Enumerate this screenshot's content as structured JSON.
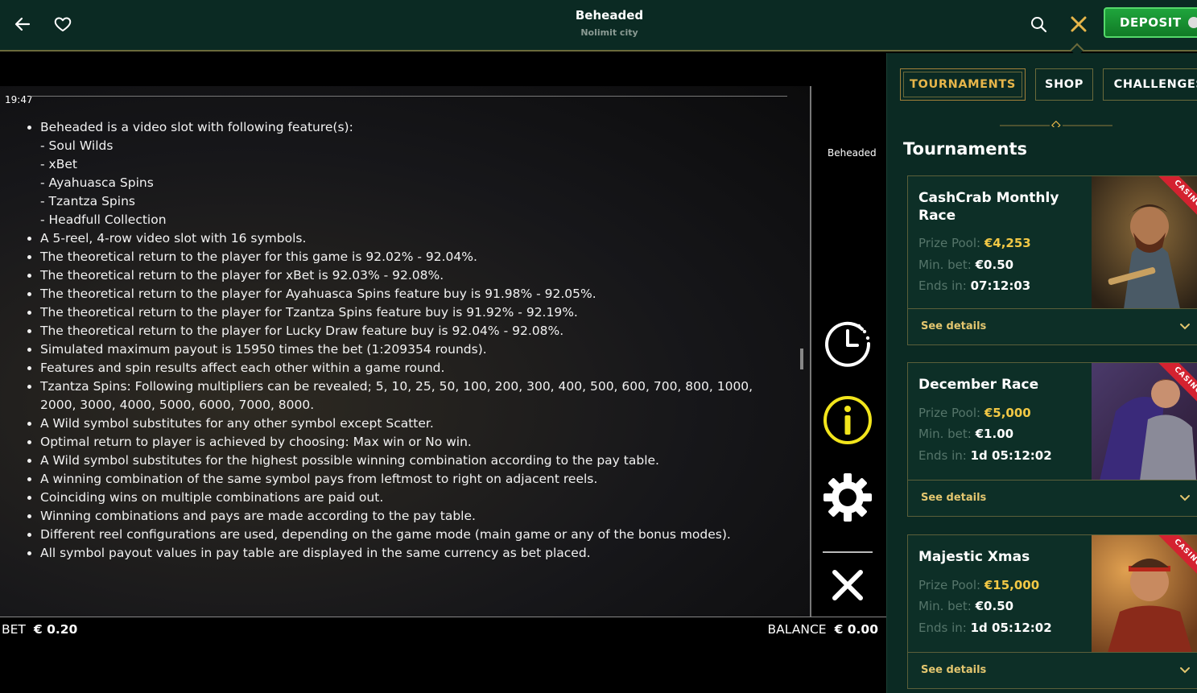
{
  "header": {
    "game_title": "Beheaded",
    "provider": "Nolimit city",
    "deposit_label": "DEPOSIT"
  },
  "game": {
    "clock": "19:47",
    "game_name": "Beheaded",
    "rules": [
      {
        "text": "Beheaded is a video slot with following feature(s):",
        "subs": [
          "- Soul Wilds",
          "- xBet",
          "- Ayahuasca Spins",
          "- Tzantza Spins",
          "- Headfull Collection"
        ]
      },
      {
        "text": "A 5-reel, 4-row video slot with 16 symbols."
      },
      {
        "text": "The theoretical return to the player for this game is 92.02% - 92.04%."
      },
      {
        "text": "The theoretical return to the player for xBet is 92.03% - 92.08%."
      },
      {
        "text": "The theoretical return to the player for Ayahuasca Spins feature buy is 91.98% - 92.05%."
      },
      {
        "text": "The theoretical return to the player for Tzantza Spins feature buy is 91.92% - 92.19%."
      },
      {
        "text": "The theoretical return to the player for Lucky Draw feature buy is 92.04% - 92.08%."
      },
      {
        "text": "Simulated maximum payout is 15950 times the bet (1:209354 rounds)."
      },
      {
        "text": "Features and spin results affect each other within a game round."
      },
      {
        "text": "Tzantza Spins: Following multipliers can be revealed; 5, 10, 25, 50, 100, 200, 300, 400, 500, 600, 700, 800, 1000, 2000, 3000, 4000, 5000, 6000, 7000, 8000."
      },
      {
        "text": "A Wild symbol substitutes for any other symbol except Scatter."
      },
      {
        "text": "Optimal return to player is achieved by choosing: Max win or No win."
      },
      {
        "text": "A Wild symbol substitutes for the highest possible winning combination according to the pay table."
      },
      {
        "text": "A winning combination of the same symbol pays from leftmost to right on adjacent reels."
      },
      {
        "text": "Coinciding wins on multiple combinations are paid out."
      },
      {
        "text": "Winning combinations and pays are made according to the pay table."
      },
      {
        "text": "Different reel configurations are used, depending on the game mode (main game or any of the bonus modes)."
      },
      {
        "text": "All symbol payout values in pay table are displayed in the same currency as bet placed."
      }
    ],
    "bet_label": "BET",
    "bet_value": "€ 0.20",
    "balance_label": "BALANCE",
    "balance_value": "€ 0.00"
  },
  "panel": {
    "tabs": [
      {
        "label": "TOURNAMENTS",
        "active": true
      },
      {
        "label": "SHOP",
        "active": false
      },
      {
        "label": "CHALLENGES",
        "active": false
      }
    ],
    "title": "Tournaments",
    "cards": [
      {
        "name": "CashCrab Monthly Race",
        "prize_label": "Prize Pool:",
        "prize": "€4,253",
        "minbet_label": "Min. bet:",
        "minbet": "€0.50",
        "ends_label": "Ends in:",
        "ends": "07:12:03",
        "ribbon": "CASINO",
        "details": "See details"
      },
      {
        "name": "December Race",
        "prize_label": "Prize Pool:",
        "prize": "€5,000",
        "minbet_label": "Min. bet:",
        "minbet": "€1.00",
        "ends_label": "Ends in:",
        "ends": "1d 05:12:02",
        "ribbon": "CASINO",
        "details": "See details"
      },
      {
        "name": "Majestic Xmas",
        "prize_label": "Prize Pool:",
        "prize": "€15,000",
        "minbet_label": "Min. bet:",
        "minbet": "€0.50",
        "ends_label": "Ends in:",
        "ends": "1d 05:12:02",
        "ribbon": "CASINO",
        "details": "See details"
      }
    ]
  },
  "colors": {
    "accent_gold": "#e6b54a",
    "panel_bg": "#0b2a23",
    "deposit_green": "#1fa53c",
    "info_yellow": "#f2e51c"
  }
}
